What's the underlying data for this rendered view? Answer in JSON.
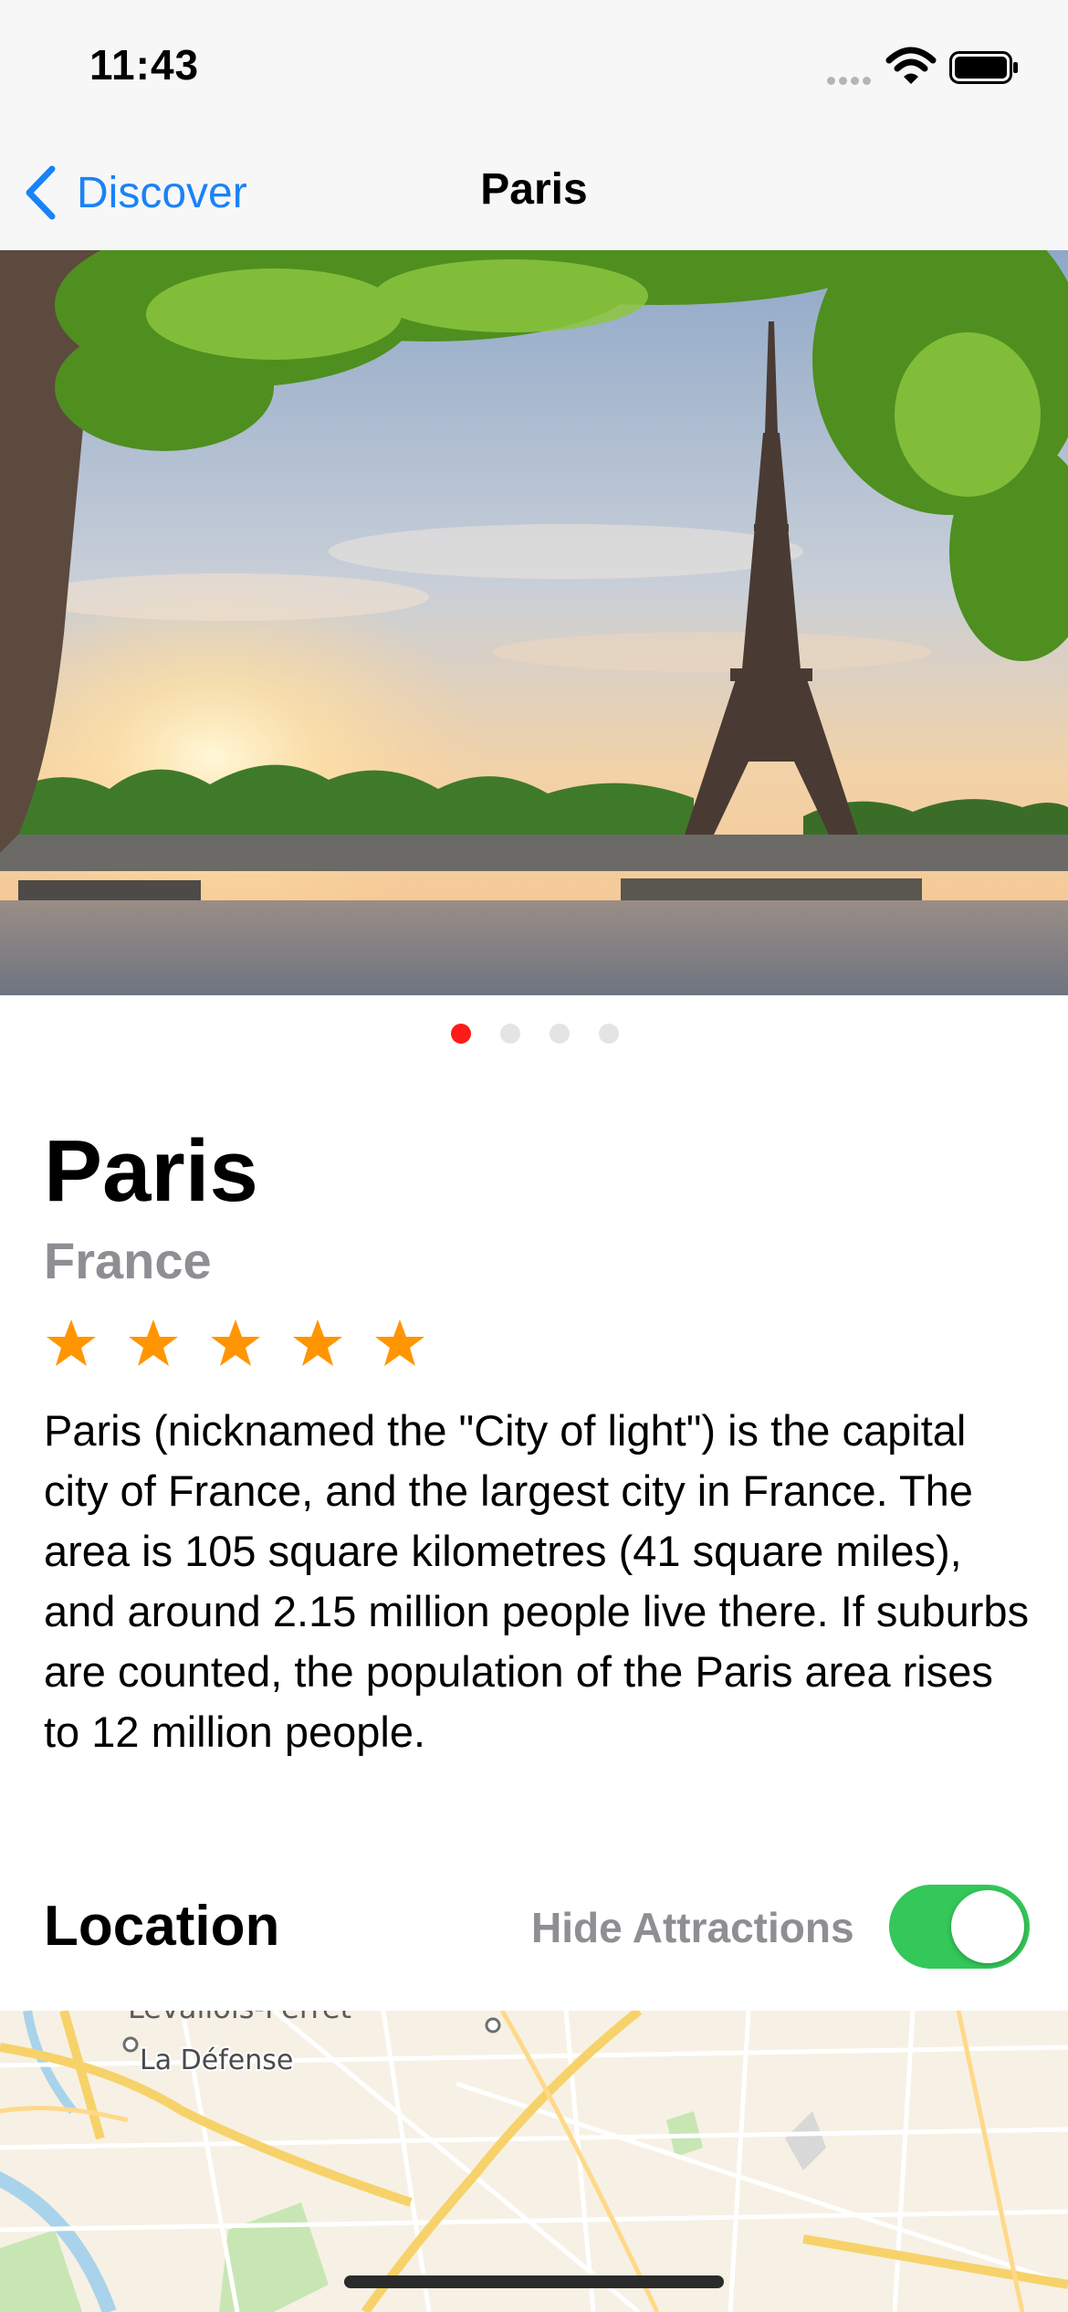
{
  "status_bar": {
    "time": "11:43"
  },
  "nav": {
    "back_label": "Discover",
    "title": "Paris"
  },
  "gallery": {
    "page_count": 4,
    "current_page": 1
  },
  "city": {
    "name": "Paris",
    "country": "France",
    "rating": 5,
    "rating_max": 5,
    "description": "Paris (nicknamed the \"City of light\") is the capital city of France, and the largest city in France. The area is 105 square kilometres (41 square miles), and around 2.15 million people live there. If suburbs are counted, the population of the Paris area rises to 12 million people."
  },
  "location": {
    "title": "Location",
    "toggle_label": "Hide Attractions",
    "toggle_on": true,
    "map_labels": {
      "place_top": "Levallois-Perret",
      "place_main": "La Défense"
    }
  },
  "colors": {
    "accent": "#1a82f7",
    "star": "#ff9500",
    "toggle_on": "#34c759",
    "page_dot_active": "#ff1a1a"
  }
}
